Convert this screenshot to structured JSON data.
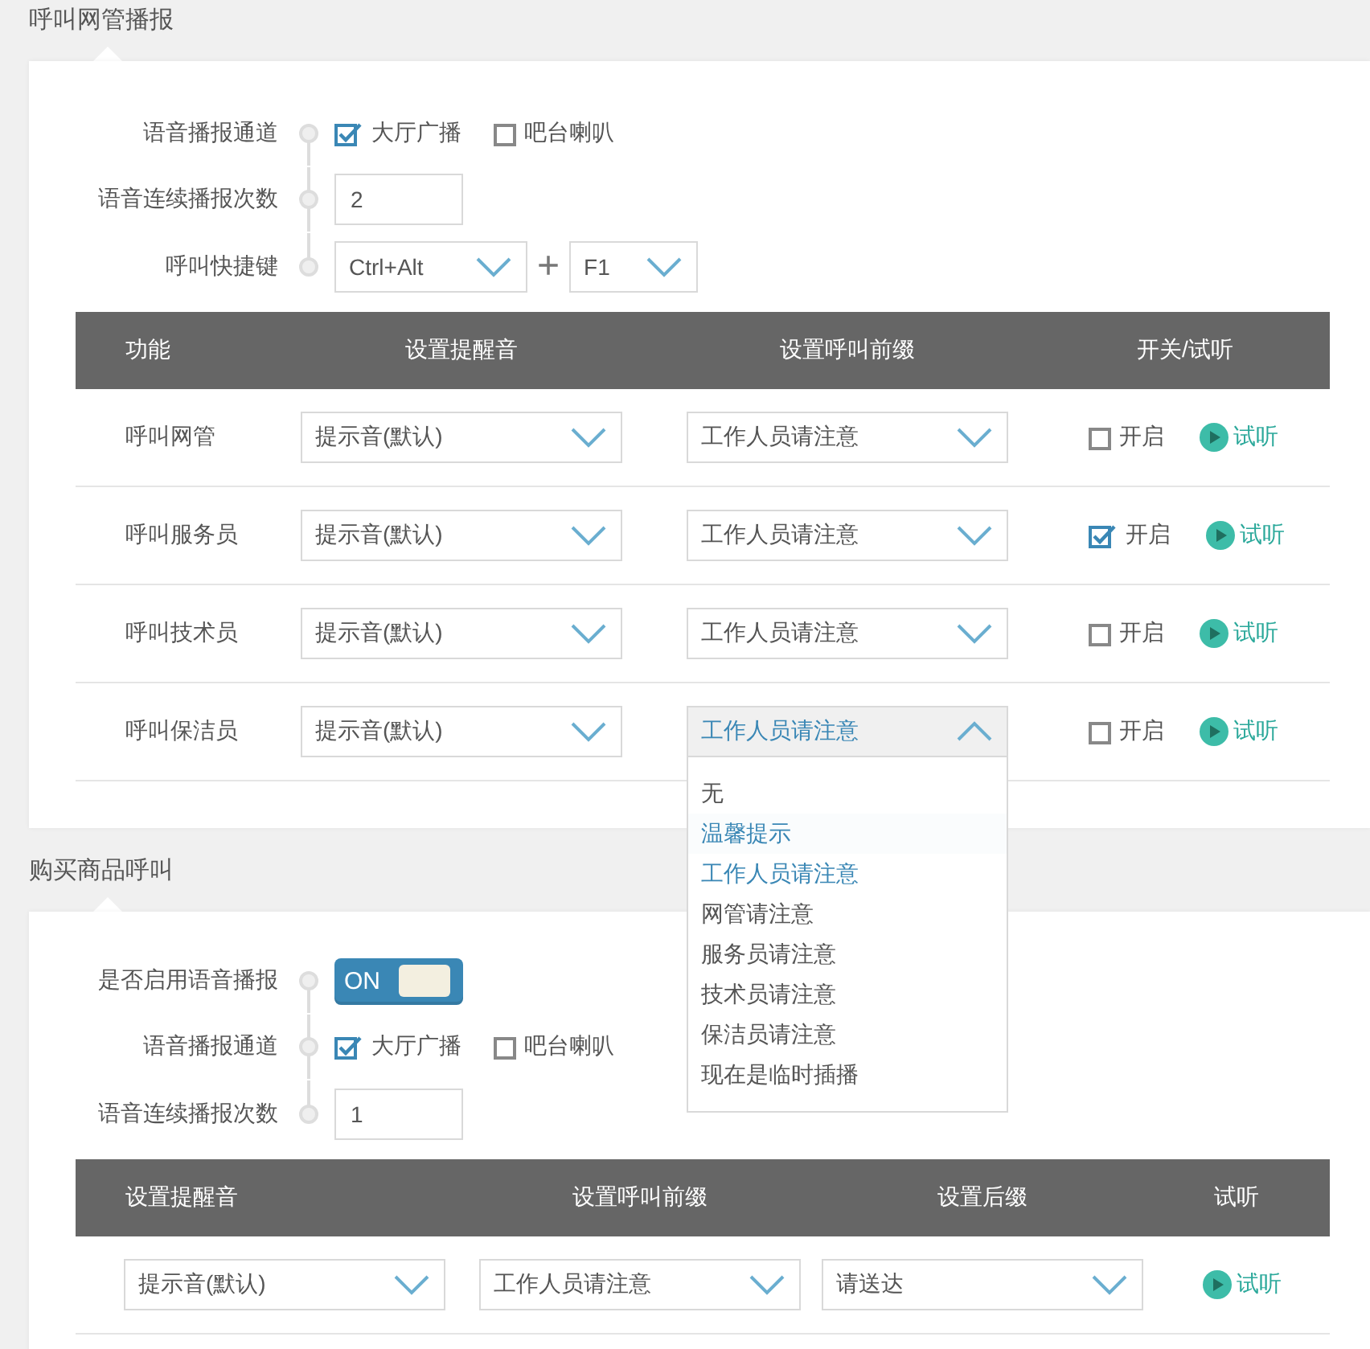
{
  "sections": [
    {
      "title": "呼叫网管播报",
      "form": [
        {
          "kind": "checks",
          "label": "语音播报通道",
          "options": [
            {
              "label": "大厅广播",
              "checked": true
            },
            {
              "label": "吧台喇叭",
              "checked": false
            }
          ]
        },
        {
          "kind": "input",
          "label": "语音连续播报次数",
          "value": "2"
        },
        {
          "kind": "hotkey",
          "label": "呼叫快捷键",
          "modifier": "Ctrl+Alt",
          "joiner": "+",
          "key": "F1"
        }
      ],
      "table": {
        "kind": "call",
        "columns": [
          "功能",
          "设置提醒音",
          "设置呼叫前缀",
          "开关/试听"
        ],
        "rows": [
          {
            "cells": [
              {
                "kind": "text",
                "text": "呼叫网管"
              },
              {
                "kind": "select",
                "value": "提示音(默认)"
              },
              {
                "kind": "select",
                "value": "工作人员请注意",
                "expanded": false
              },
              {
                "kind": "switch",
                "label": "开启",
                "checked": false,
                "listen": "试听"
              }
            ]
          },
          {
            "cells": [
              {
                "kind": "text",
                "text": "呼叫服务员"
              },
              {
                "kind": "select",
                "value": "提示音(默认)"
              },
              {
                "kind": "select",
                "value": "工作人员请注意",
                "expanded": false
              },
              {
                "kind": "switch",
                "label": "开启",
                "checked": true,
                "listen": "试听"
              }
            ]
          },
          {
            "cells": [
              {
                "kind": "text",
                "text": "呼叫技术员"
              },
              {
                "kind": "select",
                "value": "提示音(默认)"
              },
              {
                "kind": "select",
                "value": "工作人员请注意",
                "expanded": false
              },
              {
                "kind": "switch",
                "label": "开启",
                "checked": false,
                "listen": "试听"
              }
            ]
          },
          {
            "cells": [
              {
                "kind": "text",
                "text": "呼叫保洁员"
              },
              {
                "kind": "select",
                "value": "提示音(默认)"
              },
              {
                "kind": "select",
                "value": "工作人员请注意",
                "expanded": true,
                "options": [
                  {
                    "label": "无",
                    "selected": false,
                    "hovered": false
                  },
                  {
                    "label": "温馨提示",
                    "selected": false,
                    "hovered": true
                  },
                  {
                    "label": "工作人员请注意",
                    "selected": true,
                    "hovered": false
                  },
                  {
                    "label": "网管请注意",
                    "selected": false,
                    "hovered": false
                  },
                  {
                    "label": "服务员请注意",
                    "selected": false,
                    "hovered": false
                  },
                  {
                    "label": "技术员请注意",
                    "selected": false,
                    "hovered": false
                  },
                  {
                    "label": "保洁员请注意",
                    "selected": false,
                    "hovered": false
                  },
                  {
                    "label": "现在是临时插播",
                    "selected": false,
                    "hovered": false
                  }
                ]
              },
              {
                "kind": "switch",
                "label": "开启",
                "checked": false,
                "listen": "试听"
              }
            ]
          }
        ]
      }
    },
    {
      "title": "购买商品呼叫",
      "form": [
        {
          "kind": "toggle",
          "label": "是否启用语音播报",
          "text": "ON",
          "on": true
        },
        {
          "kind": "checks",
          "label": "语音播报通道",
          "options": [
            {
              "label": "大厅广播",
              "checked": true
            },
            {
              "label": "吧台喇叭",
              "checked": false
            }
          ]
        },
        {
          "kind": "input",
          "label": "语音连续播报次数",
          "value": "1"
        }
      ],
      "table": {
        "kind": "purchase",
        "columns": [
          "设置提醒音",
          "设置呼叫前缀",
          "设置后缀",
          "试听"
        ],
        "rows": [
          {
            "cells": [
              {
                "kind": "select",
                "value": "提示音(默认)"
              },
              {
                "kind": "select",
                "value": "工作人员请注意"
              },
              {
                "kind": "select",
                "value": "请送达"
              },
              {
                "kind": "listen",
                "listen": "试听"
              }
            ]
          }
        ]
      }
    }
  ]
}
